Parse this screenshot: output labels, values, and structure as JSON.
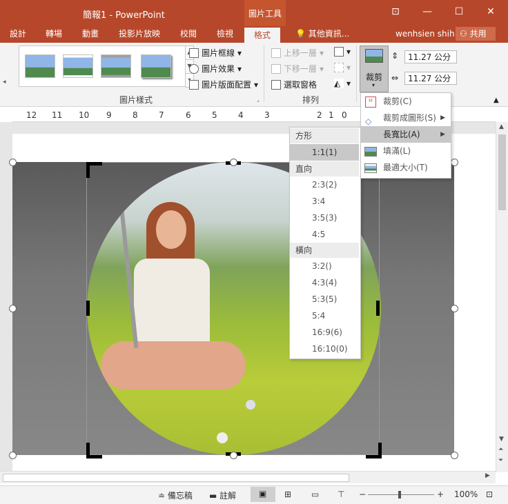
{
  "window": {
    "title": "簡報1 - PowerPoint",
    "context_group": "圖片工具",
    "buttons": {
      "ribbon_toggle": "⊡",
      "minimize": "—",
      "maximize": "☐",
      "close": "✕"
    }
  },
  "tabs": [
    {
      "label": "設計"
    },
    {
      "label": "轉場"
    },
    {
      "label": "動畫"
    },
    {
      "label": "投影片放映"
    },
    {
      "label": "校閱"
    },
    {
      "label": "檢視"
    },
    {
      "label": "格式",
      "active": true
    }
  ],
  "tell_me": "其他資訊...",
  "user": "wenhsien shih",
  "share_label": "共用",
  "ribbon": {
    "picture_styles": {
      "border": "圖片框線",
      "effects": "圖片效果",
      "layout": "圖片版面配置",
      "group_label": "圖片樣式"
    },
    "arrange": {
      "bring_forward": "上移一層",
      "send_backward": "下移一層",
      "selection_pane": "選取窗格",
      "group_label": "排列"
    },
    "crop_label": "裁剪",
    "height_value": "11.27 公分",
    "width_value": "11.27 公分"
  },
  "ruler": [
    "12",
    "11",
    "10",
    "9",
    "8",
    "7",
    "6",
    "5",
    "4",
    "3",
    "2",
    "1",
    "0"
  ],
  "crop_menu": [
    {
      "label": "裁剪(C)"
    },
    {
      "label": "裁剪成圖形(S)"
    },
    {
      "label": "長寬比(A)",
      "highlighted": true
    },
    {
      "label": "填滿(L)"
    },
    {
      "label": "最適大小(T)"
    }
  ],
  "aspect_menu": {
    "square_header": "方形",
    "square": [
      "1:1(1)"
    ],
    "portrait_header": "直向",
    "portrait": [
      "2:3(2)",
      "3:4",
      "3:5(3)",
      "4:5"
    ],
    "landscape_header": "橫向",
    "landscape": [
      "3:2()",
      "4:3(4)",
      "5:3(5)",
      "5:4",
      "16:9(6)",
      "16:10(0)"
    ]
  },
  "statusbar": {
    "notes": "備忘稿",
    "comments": "註解",
    "zoom": "100%"
  },
  "colors": {
    "accent": "#b7472a",
    "ribbon_bg": "#f3f3f3",
    "menu_highlight": "#c8c8c8"
  }
}
